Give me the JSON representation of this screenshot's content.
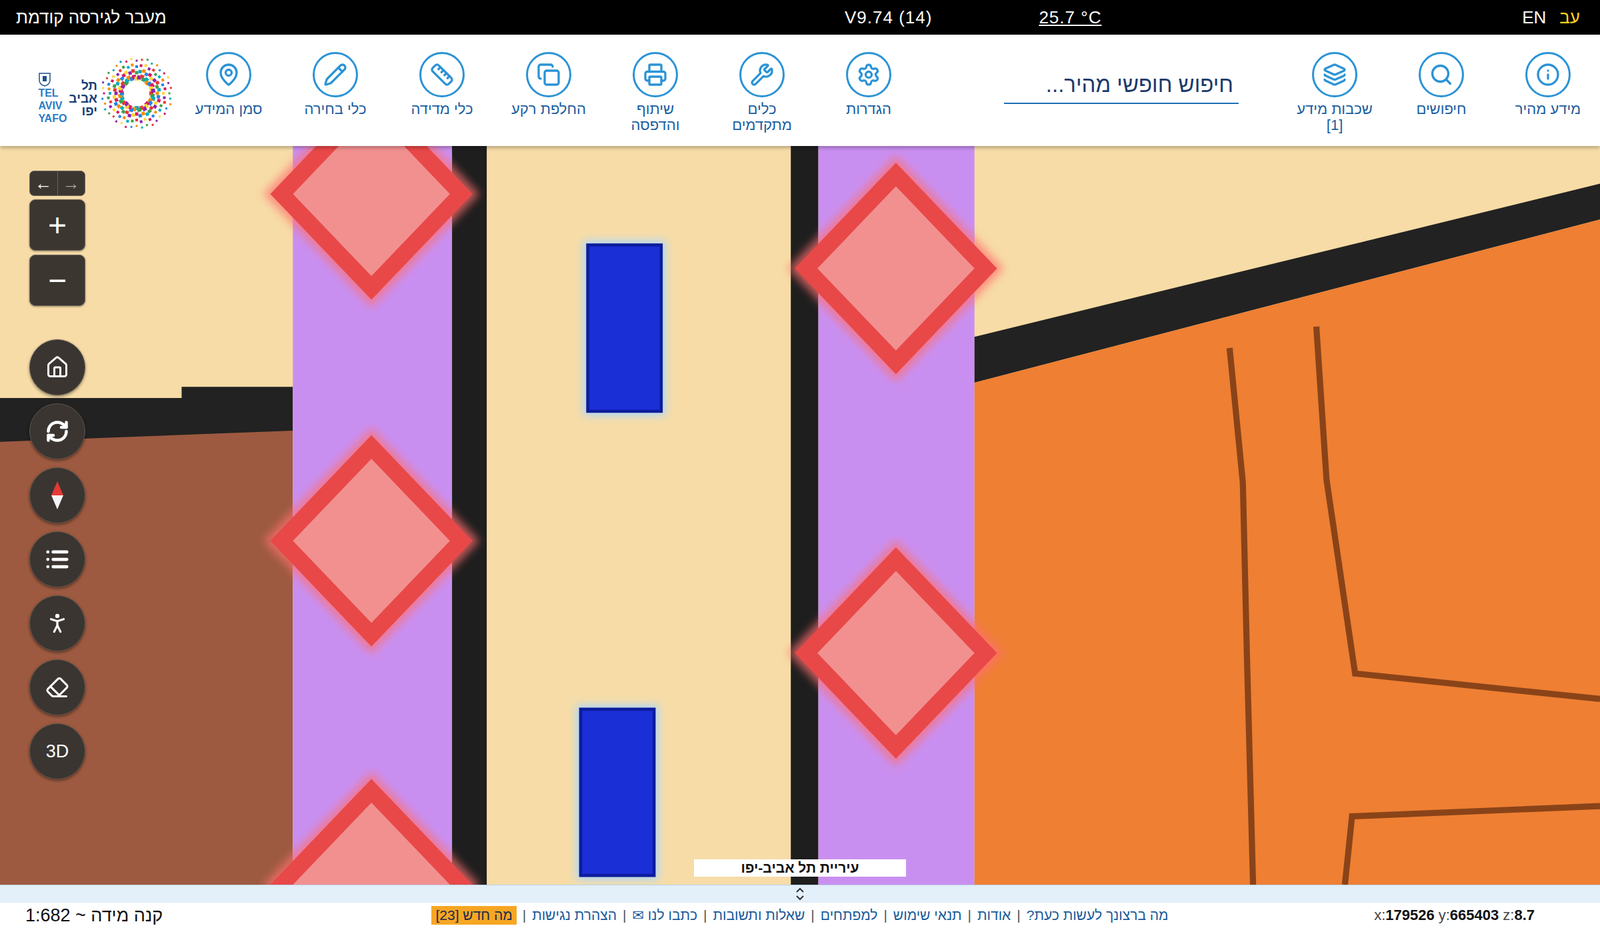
{
  "top_bar": {
    "previous_version_link": "מעבר לגירסה קודמת",
    "version": "V9.74 (14)",
    "temperature": "25.7 °C",
    "languages": [
      {
        "label": "EN",
        "selected": false
      },
      {
        "label": "עב",
        "selected": true
      }
    ]
  },
  "logo": {
    "english": [
      "TEL",
      "AVIV",
      "YAFO"
    ],
    "hebrew": [
      "תל",
      "אביב",
      "יפו"
    ]
  },
  "toolbar": {
    "right_buttons": [
      {
        "lines": [
          "מידע מהיר"
        ]
      },
      {
        "lines": [
          "חיפושים"
        ]
      },
      {
        "lines": [
          "שכבות מידע",
          "[1]"
        ]
      }
    ],
    "search": {
      "placeholder": "חיפוש חופשי מהיר..."
    },
    "left_buttons": [
      {
        "lines": [
          "הגדרות"
        ]
      },
      {
        "lines": [
          "כלים",
          "מתקדמים"
        ]
      },
      {
        "lines": [
          "שיתוף",
          "והדפסה"
        ]
      },
      {
        "lines": [
          "החלפת רקע"
        ]
      },
      {
        "lines": [
          "כלי מדידה"
        ]
      },
      {
        "lines": [
          "כלי בחירה"
        ]
      },
      {
        "lines": [
          "סמן המידע"
        ]
      }
    ]
  },
  "map_controls": {
    "history": [
      "←",
      "→"
    ],
    "zoom": [
      "+",
      "−"
    ],
    "view_3d": "3D"
  },
  "map": {
    "attribution": "עיריית תל אביב-יפו"
  },
  "status_bar": {
    "scale": "קנה מידה ~ 1:682",
    "links": [
      "מה ברצונך לעשות כעת?",
      "אודות",
      "תנאי שימוש",
      "למפתחים",
      "שאלות ותשובות",
      "כתבו לנו ✉",
      "הצהרת נגישות"
    ],
    "separator": "|",
    "whats_new": "מה חדש [23]",
    "coordinates": [
      {
        "label": "x:",
        "value": "179526"
      },
      {
        "label": "y:",
        "value": "665403"
      },
      {
        "label": "z:",
        "value": "8.7"
      }
    ]
  }
}
